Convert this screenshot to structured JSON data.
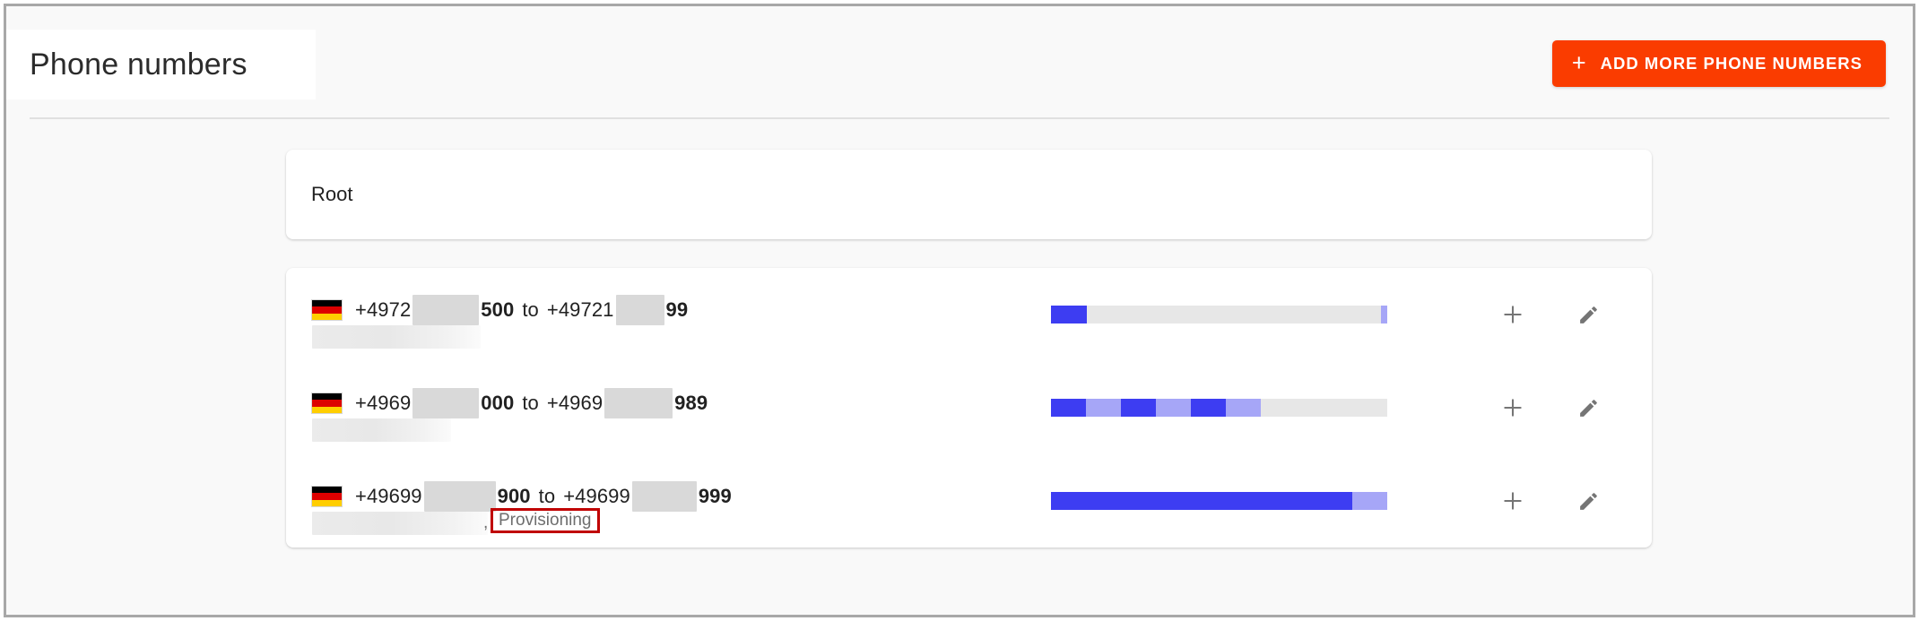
{
  "header": {
    "title": "Phone numbers",
    "add_button": {
      "label": "ADD MORE PHONE NUMBERS",
      "icon": "plus-icon",
      "color": "#fa3c00"
    }
  },
  "root_card": {
    "label": "Root"
  },
  "colors": {
    "accent": "#fa3c00",
    "bar_used": "#3d3df2",
    "bar_reserved": "#a6a6f7",
    "bar_empty": "#e7e7e7",
    "highlight_border": "#c00000",
    "page_background": "#f9f9f9",
    "card_background": "#ffffff"
  },
  "rows": [
    {
      "flag": "de-flag-icon",
      "range": {
        "prefix_start": "+4972",
        "redacted_start": "██████",
        "suffix_start": "500",
        "separator": "to",
        "prefix_end": "+49721",
        "redacted_end": "██████",
        "suffix_end": "99"
      },
      "subtitle_redacted": true,
      "status": null,
      "bar": [
        {
          "state": "used",
          "percent": 10.7
        },
        {
          "state": "empty",
          "percent": 87.5
        },
        {
          "state": "reserved",
          "percent": 1.8
        }
      ],
      "actions": [
        "plus-icon",
        "pencil-icon"
      ]
    },
    {
      "flag": "de-flag-icon",
      "range": {
        "prefix_start": "+4969",
        "redacted_start": "██████",
        "suffix_start": "000",
        "separator": "to",
        "prefix_end": "+4969",
        "redacted_end": "█████",
        "suffix_end": "989"
      },
      "subtitle_redacted": true,
      "status": null,
      "bar": [
        {
          "state": "used",
          "percent": 10.4
        },
        {
          "state": "reserved",
          "percent": 10.4
        },
        {
          "state": "used",
          "percent": 10.4
        },
        {
          "state": "reserved",
          "percent": 10.4
        },
        {
          "state": "used",
          "percent": 10.4
        },
        {
          "state": "reserved",
          "percent": 10.4
        },
        {
          "state": "empty",
          "percent": 37.6
        }
      ],
      "actions": [
        "plus-icon",
        "pencil-icon"
      ]
    },
    {
      "flag": "de-flag-icon",
      "range": {
        "prefix_start": "+49699",
        "redacted_start": "██████",
        "suffix_start": "900",
        "separator": "to",
        "prefix_end": "+49699",
        "redacted_end": "██████",
        "suffix_end": "999"
      },
      "subtitle_redacted": true,
      "status": "Provisioning",
      "status_highlighted": true,
      "bar": [
        {
          "state": "used",
          "percent": 89.5
        },
        {
          "state": "reserved",
          "percent": 10.5
        }
      ],
      "actions": [
        "plus-icon",
        "pencil-icon"
      ]
    }
  ]
}
